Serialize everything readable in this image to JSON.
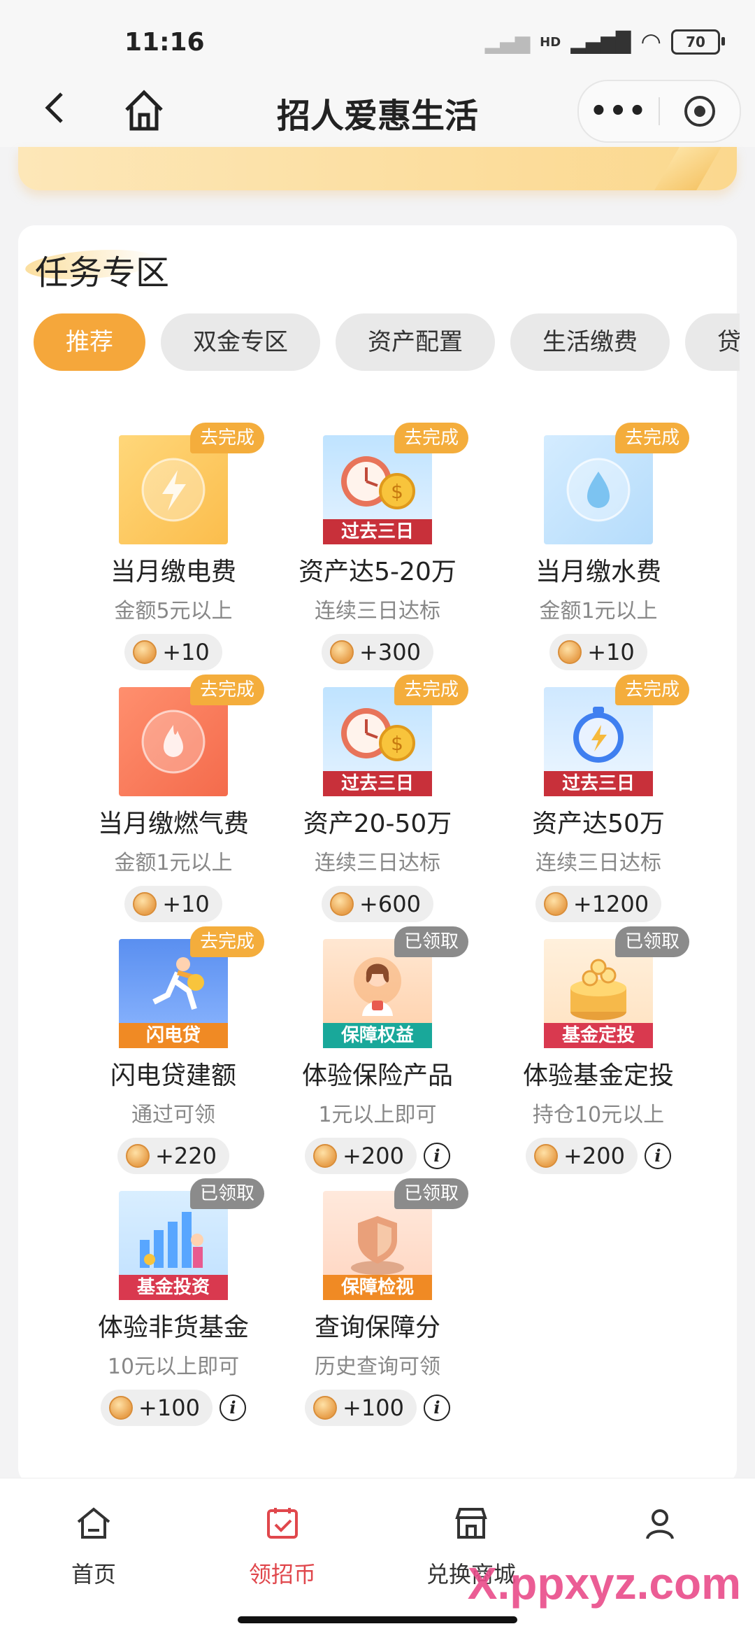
{
  "status": {
    "time": "11:16",
    "network": "HD",
    "battery": "70"
  },
  "nav": {
    "title": "招人爱惠生活",
    "more": "•••"
  },
  "section": {
    "title": "任务专区"
  },
  "tabs": [
    "推荐",
    "双金专区",
    "资产配置",
    "生活缴费",
    "贷款"
  ],
  "tasks": [
    {
      "name": "当月缴电费",
      "sub": "金额5元以上",
      "reward": "+10",
      "badge": "去完成",
      "ribbon": "",
      "info": ""
    },
    {
      "name": "资产达5-20万",
      "sub": "连续三日达标",
      "reward": "+300",
      "badge": "去完成",
      "ribbon": "过去三日",
      "info": ""
    },
    {
      "name": "当月缴水费",
      "sub": "金额1元以上",
      "reward": "+10",
      "badge": "去完成",
      "ribbon": "",
      "info": ""
    },
    {
      "name": "当月缴燃气费",
      "sub": "金额1元以上",
      "reward": "+10",
      "badge": "去完成",
      "ribbon": "",
      "info": ""
    },
    {
      "name": "资产20-50万",
      "sub": "连续三日达标",
      "reward": "+600",
      "badge": "去完成",
      "ribbon": "过去三日",
      "info": ""
    },
    {
      "name": "资产达50万",
      "sub": "连续三日达标",
      "reward": "+1200",
      "badge": "去完成",
      "ribbon": "过去三日",
      "info": ""
    },
    {
      "name": "闪电贷建额",
      "sub": "通过可领",
      "reward": "+220",
      "badge": "去完成",
      "ribbon": "闪电贷",
      "info": ""
    },
    {
      "name": "体验保险产品",
      "sub": "1元以上即可",
      "reward": "+200",
      "badge": "已领取",
      "ribbon": "保障权益",
      "info": "i"
    },
    {
      "name": "体验基金定投",
      "sub": "持仓10元以上",
      "reward": "+200",
      "badge": "已领取",
      "ribbon": "基金定投",
      "info": "i"
    },
    {
      "name": "体验非货基金",
      "sub": "10元以上即可",
      "reward": "+100",
      "badge": "已领取",
      "ribbon": "基金投资",
      "info": "i"
    },
    {
      "name": "查询保障分",
      "sub": "历史查询可领",
      "reward": "+100",
      "badge": "已领取",
      "ribbon": "保障检视",
      "info": "i"
    }
  ],
  "tabbar": {
    "home": "首页",
    "coins": "领招币",
    "mall": "兑换商城"
  },
  "watermark": "X.ppxyz.com",
  "colors": {
    "accent": "#f5a73b",
    "badge_todo": "#f4ad3c",
    "badge_done": "#8b8b8b",
    "tab_active_text": "#e0474c",
    "ribbon_red": "#c8303a",
    "ribbon_orange": "#f08a24",
    "ribbon_teal": "#19a89a",
    "ribbon_pink": "#d9394f"
  }
}
